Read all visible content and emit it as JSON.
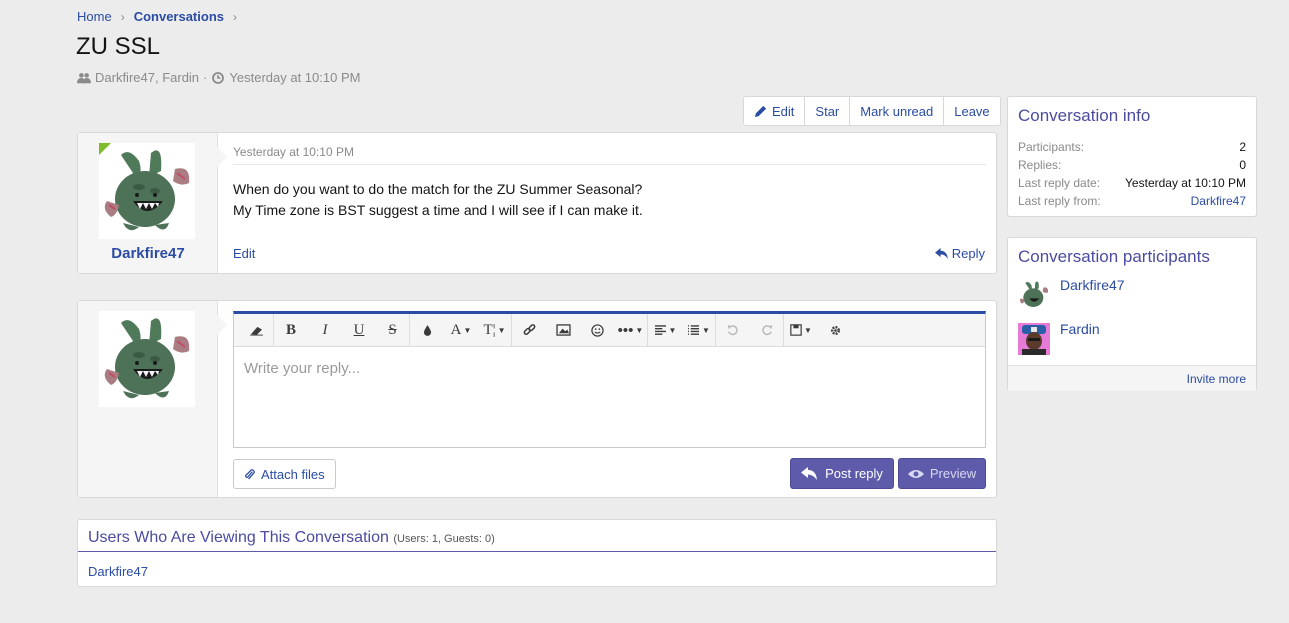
{
  "breadcrumb": {
    "home": "Home",
    "current": "Conversations",
    "separator": "›"
  },
  "page": {
    "title": "ZU SSL",
    "participants": "Darkfire47, Fardin",
    "dot": "·",
    "time": "Yesterday at 10:10 PM"
  },
  "actions": {
    "edit": "Edit",
    "star": "Star",
    "mark_unread": "Mark unread",
    "leave": "Leave"
  },
  "message": {
    "author": "Darkfire47",
    "date": "Yesterday at 10:10 PM",
    "line1": "When do you want to do the match for the ZU Summer Seasonal?",
    "line2": "My Time zone is BST suggest a time and I will see if I can make it.",
    "edit": "Edit",
    "reply": "Reply"
  },
  "reply_editor": {
    "placeholder": "Write your reply...",
    "attach": "Attach files",
    "post": "Post reply",
    "preview": "Preview",
    "toolbar_icons": [
      "eraser-icon",
      "bold-icon",
      "italic-icon",
      "underline-icon",
      "strike-icon",
      "color-icon",
      "font-size-icon",
      "text-style-icon",
      "link-icon",
      "image-icon",
      "smiley-icon",
      "more-icon",
      "align-icon",
      "list-icon",
      "undo-icon",
      "redo-icon",
      "save-draft-icon",
      "settings-icon"
    ]
  },
  "viewing": {
    "title": "Users Who Are Viewing This Conversation",
    "counts": "(Users: 1, Guests: 0)",
    "users": "Darkfire47"
  },
  "info": {
    "title": "Conversation info",
    "rows": [
      {
        "label": "Participants:",
        "value": "2"
      },
      {
        "label": "Replies:",
        "value": "0"
      },
      {
        "label": "Last reply date:",
        "value": "Yesterday at 10:10 PM"
      },
      {
        "label": "Last reply from:",
        "value": "Darkfire47"
      }
    ]
  },
  "participants_block": {
    "title": "Conversation participants",
    "users": [
      "Darkfire47",
      "Fardin"
    ],
    "invite": "Invite more"
  },
  "colors": {
    "accent": "#2b4ca3",
    "button": "#5e5bab",
    "online": "#7fbc2a",
    "background": "#ececec"
  }
}
